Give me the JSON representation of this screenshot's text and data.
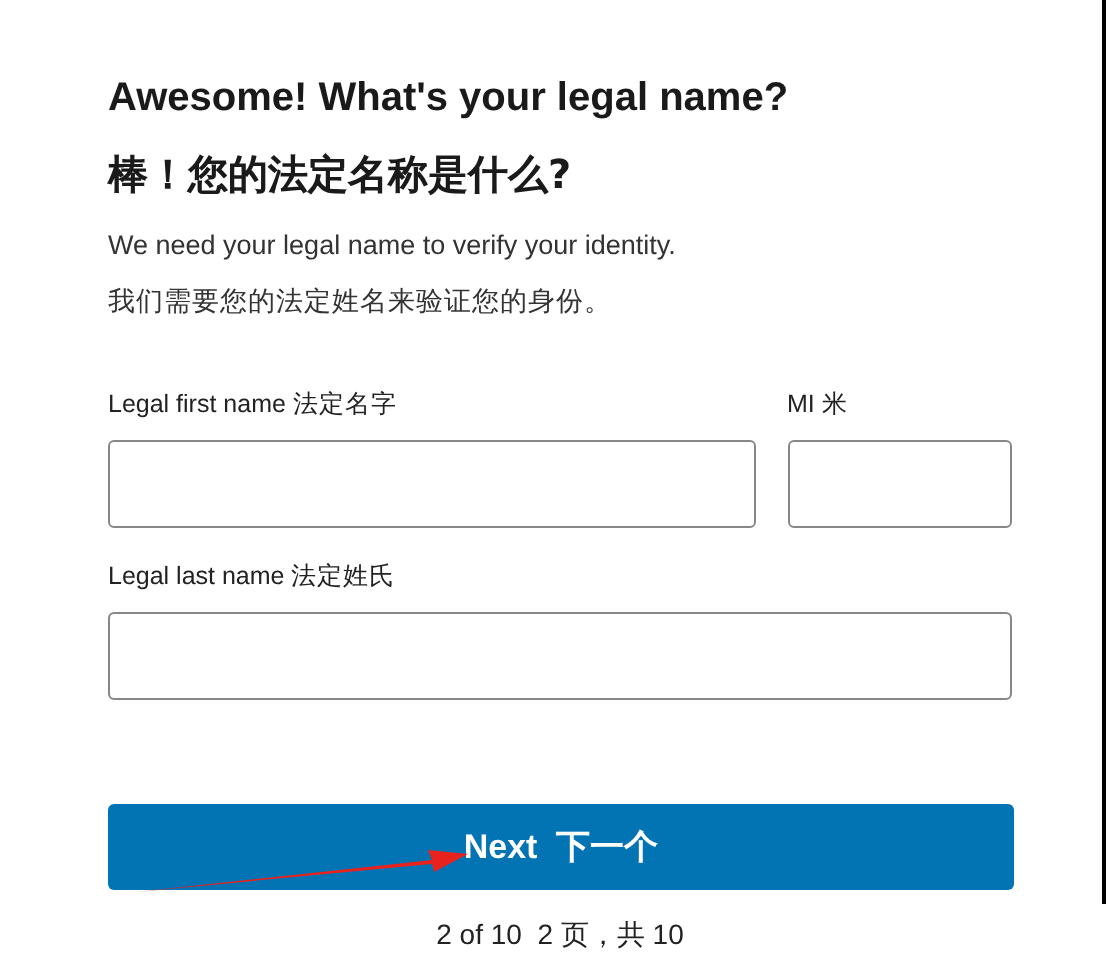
{
  "heading": "Awesome! What's your legal name?",
  "heading_zh": "棒！您的法定名称是什么?",
  "description": "We need your legal name to verify your identity.",
  "description_zh": "我们需要您的法定姓名来验证您的身份。",
  "fields": [
    {
      "label": "Legal first name 法定名字",
      "kind": "wide"
    },
    {
      "label": "MI 米",
      "kind": "narrow"
    },
    {
      "label": "Legal last name 法定姓氏",
      "kind": "full"
    }
  ],
  "next_button": "Next  下一个",
  "pagination": "2 of 10  2 页，共 10"
}
